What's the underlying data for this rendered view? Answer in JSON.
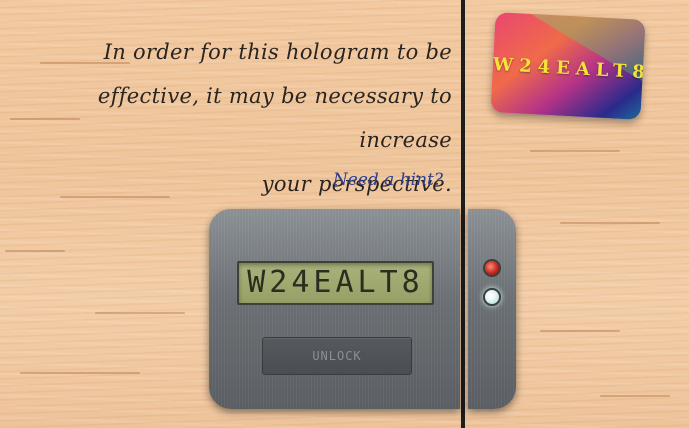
{
  "instructions": {
    "line1": "In order for this hologram to be",
    "line2": "effective, it may be necessary to increase",
    "line3": "your perspective."
  },
  "hint": {
    "label": "Need a hint?",
    "color": "#2c3f8f"
  },
  "hologram_card": {
    "code": "W24EALT8"
  },
  "lock": {
    "display_value": "W24EALT8",
    "unlock_label": "UNLOCK",
    "indicators": [
      {
        "name": "status-led-red",
        "color": "#c8281e"
      },
      {
        "name": "status-led-white",
        "color": "#e8f6f4"
      }
    ]
  }
}
